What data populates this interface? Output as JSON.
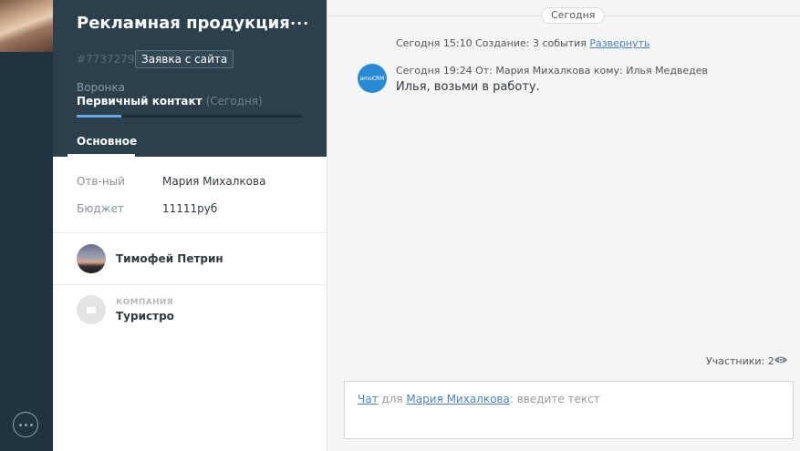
{
  "lead": {
    "title": "Рекламная продукция",
    "more_label": "···",
    "id": "#7737279",
    "source_tag": "Заявка с сайта",
    "pipeline_label": "Воронка",
    "stage": "Первичный контакт",
    "stage_date": "(Сегодня)",
    "stage_progress_percent": 20,
    "tab_main": "Основное"
  },
  "fields": [
    {
      "label": "Отв-ный",
      "value": "Мария Михалкова"
    },
    {
      "label": "Бюджет",
      "value": "11111руб"
    }
  ],
  "contact": {
    "name": "Тимофей Петрин"
  },
  "company": {
    "caption": "КОМПАНИЯ",
    "name": "Туристро"
  },
  "feed": {
    "day_label": "Сегодня",
    "system_note": {
      "text": "Сегодня 15:10 Создание: 3 события ",
      "expand_link": "Развернуть"
    },
    "message": {
      "meta": "Сегодня 19:24  От: Мария Михалкова кому: Илья Медведев",
      "text": "Илья, возьми в работу.",
      "avatar_text": "amoCRM"
    },
    "participants": "Участники: 2"
  },
  "chat": {
    "mode_link": "Чат",
    "for_text": " для ",
    "recipient_link": "Мария Михалкова",
    "colon": ":",
    "placeholder": "  введите текст"
  },
  "colors": {
    "rail": "#1f3440",
    "card_header": "#2b3f4c",
    "accent": "#6aa7e8",
    "link": "#4c83c2"
  },
  "icons": [
    "chat-bubble-icon",
    "more-icon",
    "eye-icon",
    "building-icon"
  ]
}
